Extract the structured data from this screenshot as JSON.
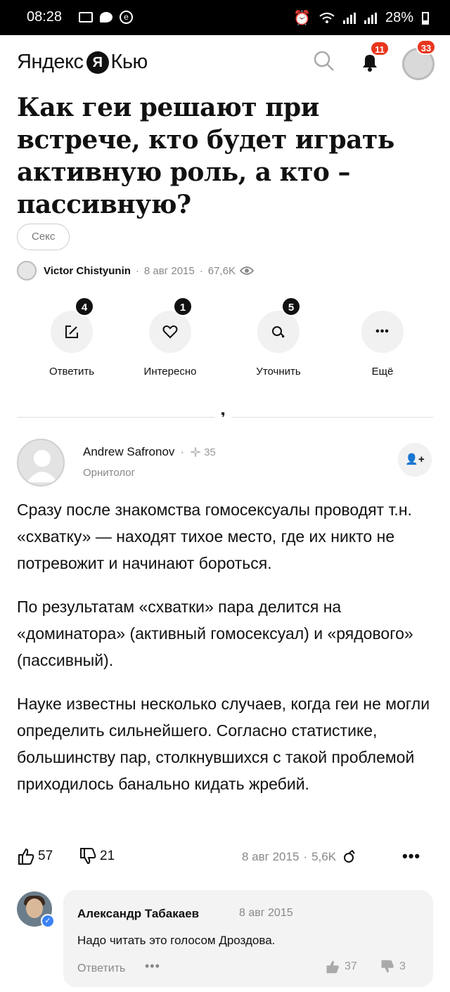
{
  "status_bar": {
    "time": "08:28",
    "battery": "28%"
  },
  "app": {
    "logo_left": "Яндекс",
    "logo_mark": "Я",
    "logo_right": "Кью",
    "notifications_count": "11",
    "profile_count": "33"
  },
  "question": {
    "title": "Как геи решают при встрече, кто будет играть активную роль, а кто – пассивную?",
    "tag": "Секс",
    "author": "Victor Chistyunin",
    "date": "8 авг 2015",
    "views": "67,6K"
  },
  "actions": [
    {
      "label": "Ответить",
      "count": "4",
      "icon": "pencil-square-icon"
    },
    {
      "label": "Интересно",
      "count": "1",
      "icon": "heart-icon"
    },
    {
      "label": "Уточнить",
      "count": "5",
      "icon": "speech-bubble-icon"
    },
    {
      "label": "Ещё",
      "count": "",
      "icon": "more-dots-icon"
    }
  ],
  "answer": {
    "author": "Andrew Safronov",
    "karma": "35",
    "role": "Орнитолог",
    "follow_label": "👤+",
    "paragraphs": [
      "Сразу после знакомства гомосексуалы проводят т.н. «схватку» — находят тихое место, где их никто не потревожит и начинают бороться.",
      "По результатам «схватки» пара делится на «доминатора» (активный гомосексуал) и «рядового» (пассивный).",
      "Науке известны несколько случаев, когда геи не могли определить сильнейшего. Согласно статистике, большинству пар, столкнувшихся с такой проблемой приходилось банально кидать жребий."
    ],
    "likes": "57",
    "dislikes": "21",
    "date": "8 авг 2015",
    "views": "5,6K",
    "more": "•••"
  },
  "comment": {
    "author": "Александр Табакаев",
    "date": "8 авг 2015",
    "text": "Надо читать это голосом Дроздова.",
    "reply_label": "Ответить",
    "more": "•••",
    "likes": "37",
    "dislikes": "3"
  },
  "colors": {
    "badge_red": "#e8361d",
    "accent_blue": "#3b82f6",
    "muted_text": "#888888"
  }
}
